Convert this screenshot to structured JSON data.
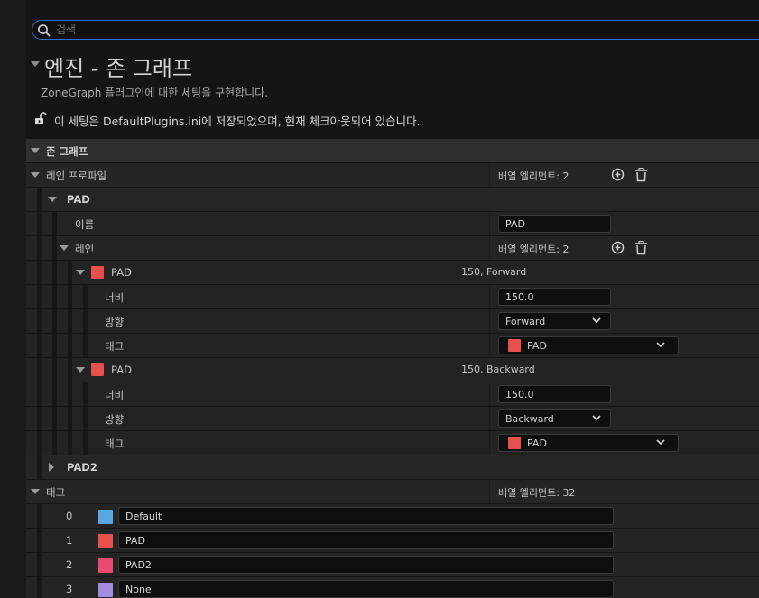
{
  "search": {
    "placeholder": "검색"
  },
  "header": {
    "title": "엔진 - 존 그래프",
    "subtitle": "ZoneGraph 플러그인에 대한 세팅을 구현합니다.",
    "lock_message": "이 세팅은 DefaultPlugins.ini에 저장되었으며, 현재 체크아웃되어 있습니다."
  },
  "category": {
    "label": "존 그래프"
  },
  "lane_profiles": {
    "label": "레인 프로파일",
    "count": "배열 엘리먼트: 2",
    "pad": {
      "label": "PAD",
      "name_label": "이름",
      "name_value": "PAD",
      "lanes_label": "레인",
      "lanes_count": "배열 엘리먼트: 2",
      "lanes": [
        {
          "label": "PAD",
          "summary": "150, Forward",
          "color": "#e5524e",
          "width_label": "너비",
          "width_value": "150.0",
          "direction_label": "방향",
          "direction_value": "Forward",
          "tag_label": "태그",
          "tag_value": "PAD",
          "tag_color": "#e5524e"
        },
        {
          "label": "PAD",
          "summary": "150, Backward",
          "color": "#e5524e",
          "width_label": "너비",
          "width_value": "150.0",
          "direction_label": "방향",
          "direction_value": "Backward",
          "tag_label": "태그",
          "tag_value": "PAD",
          "tag_color": "#e5524e"
        }
      ]
    },
    "pad2": {
      "label": "PAD2"
    }
  },
  "tags": {
    "label": "태그",
    "count": "배열 엘리먼트: 32",
    "items": [
      {
        "index": "0",
        "name": "Default",
        "color": "#59a8e2"
      },
      {
        "index": "1",
        "name": "PAD",
        "color": "#e5524e"
      },
      {
        "index": "2",
        "name": "PAD2",
        "color": "#e84a72"
      },
      {
        "index": "3",
        "name": "None",
        "color": "#a48ce0"
      }
    ]
  },
  "icons": {
    "search": "search-icon",
    "lock": "unlock-icon",
    "add": "add-icon",
    "delete": "trash-icon"
  },
  "colors": {
    "search_border": "#2d6fc9"
  }
}
